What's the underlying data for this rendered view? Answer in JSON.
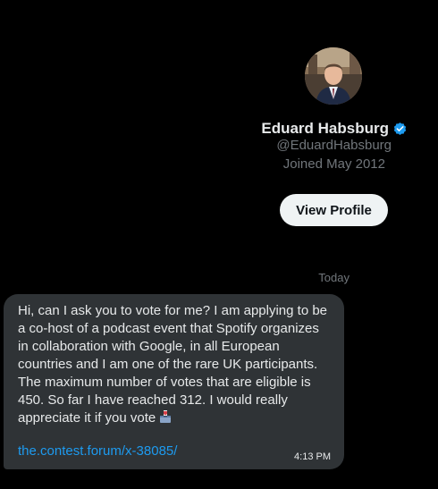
{
  "profile": {
    "display_name": "Eduard Habsburg",
    "handle": "@EduardHabsburg",
    "joined": "Joined May 2012",
    "verified": true,
    "avatar_icon": "user-avatar-photo",
    "view_profile_label": "View Profile"
  },
  "conversation": {
    "date_divider": "Today",
    "messages": [
      {
        "text": "Hi, can I ask you to vote for me? I am applying to be a co-host of a podcast event that Spotify organizes in collaboration with Google, in all European countries and I am one of the rare UK participants. The maximum number of votes that are eligible is 450. So far I have reached 312. I would really appreciate it if you vote",
        "emoji": "ballot-box-icon",
        "link": "the.contest.forum/x-38085/",
        "time": "4:13 PM"
      }
    ]
  },
  "colors": {
    "background": "#000000",
    "bubble": "#2f3336",
    "link": "#1d9bf0",
    "verified": "#1d9bf0",
    "muted_text": "#71767b"
  }
}
